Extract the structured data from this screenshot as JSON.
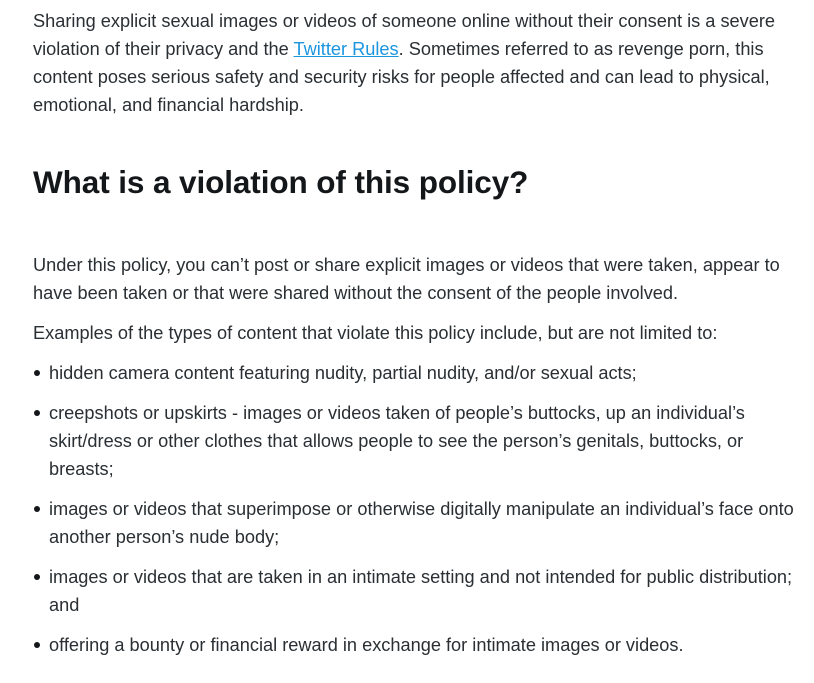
{
  "intro": {
    "before_link": "Sharing explicit sexual images or videos of someone online without their consent is a severe violation of their privacy and the ",
    "link_text": "Twitter Rules",
    "after_link": ". Sometimes referred to as revenge porn, this content poses serious safety and security risks for people affected and can lead to physical, emotional, and financial hardship."
  },
  "heading": "What is a violation of this policy?",
  "policy_paragraph": "Under this policy, you can’t post or share explicit images or videos that were taken, appear to have been taken or that were shared without the consent of the people involved.",
  "examples_intro": "Examples of the types of content that violate this policy include, but are not limited to:",
  "examples": [
    "hidden camera content featuring nudity, partial nudity, and/or sexual acts;",
    "creepshots or upskirts - images or videos taken of people’s buttocks, up an individual’s skirt/dress or other clothes that allows people to see the person’s genitals, buttocks, or breasts;",
    "images or videos that superimpose or otherwise digitally manipulate an individual’s face onto another person’s nude body;",
    "images or videos that are taken in an intimate setting and not intended for public distribution; and",
    "offering a bounty or financial reward in exchange for intimate images or videos."
  ],
  "colors": {
    "text": "#292f33",
    "heading": "#14171a",
    "link": "#1b95e0",
    "background": "#ffffff"
  }
}
